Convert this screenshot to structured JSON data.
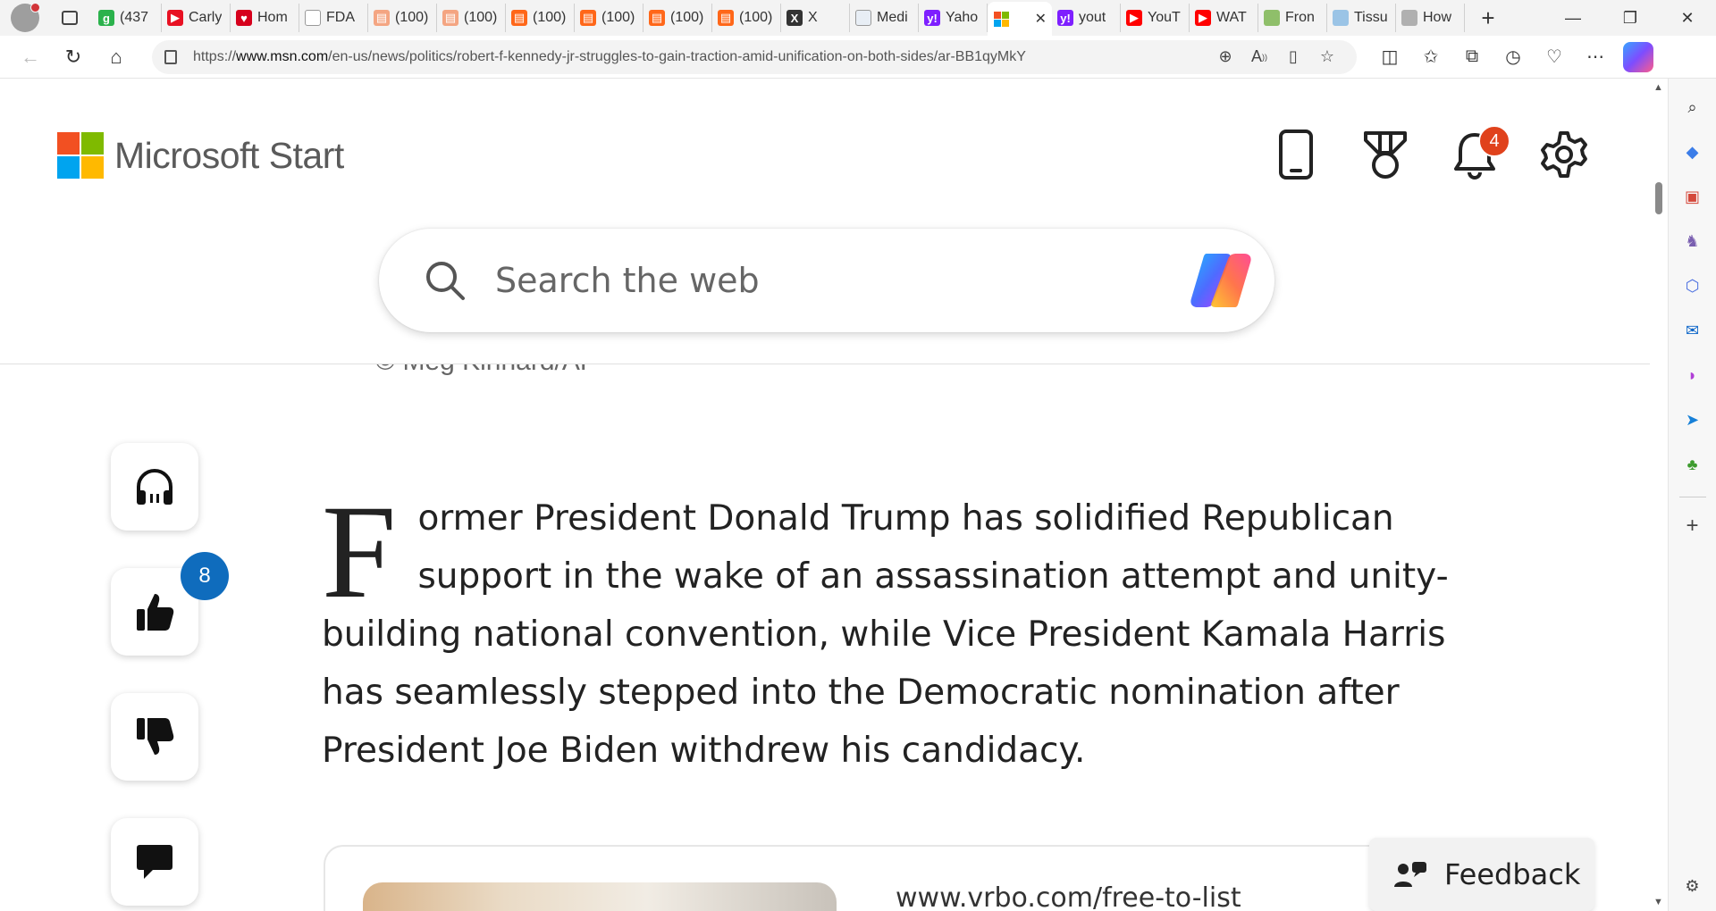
{
  "browser": {
    "tabs": [
      {
        "label": "(437",
        "fav_color": "#2bb24c",
        "fav_text": "g"
      },
      {
        "label": "Carly",
        "fav_color": "#e81123",
        "fav_text": "▶"
      },
      {
        "label": "Hom",
        "fav_color": "#d6001c",
        "fav_text": "♥"
      },
      {
        "label": "FDA",
        "fav_color": "#ffffff",
        "fav_text": ""
      },
      {
        "label": "(100)",
        "fav_color": "#f4a582",
        "fav_text": "▤"
      },
      {
        "label": "(100)",
        "fav_color": "#f4a582",
        "fav_text": "▤"
      },
      {
        "label": "(100)",
        "fav_color": "#ff6719",
        "fav_text": "▤"
      },
      {
        "label": "(100)",
        "fav_color": "#ff6719",
        "fav_text": "▤"
      },
      {
        "label": "(100)",
        "fav_color": "#ff6719",
        "fav_text": "▤"
      },
      {
        "label": "(100)",
        "fav_color": "#ff6719",
        "fav_text": "▤"
      },
      {
        "label": "X",
        "fav_color": "#333333",
        "fav_text": "X"
      },
      {
        "label": "Medi",
        "fav_color": "#e8eef5",
        "fav_text": ""
      },
      {
        "label": "Yaho",
        "fav_color": "#7e1fff",
        "fav_text": "y!"
      },
      {
        "label": "",
        "fav_color": "#ffffff",
        "fav_text": "",
        "active": true
      },
      {
        "label": "yout",
        "fav_color": "#7e1fff",
        "fav_text": "y!"
      },
      {
        "label": "YouT",
        "fav_color": "#ff0000",
        "fav_text": "▶"
      },
      {
        "label": "WAT",
        "fav_color": "#ff0000",
        "fav_text": "▶"
      },
      {
        "label": "Fron",
        "fav_color": "#8fbf6a",
        "fav_text": ""
      },
      {
        "label": "Tissu",
        "fav_color": "#9bc4e6",
        "fav_text": ""
      },
      {
        "label": "How",
        "fav_color": "#b0b0b0",
        "fav_text": ""
      }
    ],
    "url_prefix": "https://",
    "url_domain": "www.msn.com",
    "url_path": "/en-us/news/politics/robert-f-kennedy-jr-struggles-to-gain-traction-amid-unification-on-both-sides/ar-BB1qyMkY"
  },
  "header": {
    "brand": "Microsoft Start",
    "notification_count": "4"
  },
  "search": {
    "placeholder": "Search the web"
  },
  "article": {
    "photo_credit": "© Meg Kinnard/AP",
    "dropcap": "F",
    "paragraph": "ormer President Donald Trump has solidified Republican support in the wake of an assassination attempt and unity-building national convention, while Vice President Kamala Harris has seamlessly stepped into the Democratic nomination after President Joe Biden withdrew his candidacy.",
    "like_count": "8"
  },
  "ad": {
    "url": "www.vrbo.com/free-to-list"
  },
  "feedback": {
    "label": "Feedback"
  },
  "colors": {
    "ms_red": "#f25022",
    "ms_green": "#7fba00",
    "ms_blue": "#00a4ef",
    "ms_yellow": "#ffb900",
    "notif_badge": "#e0421c",
    "like_badge": "#0f6cbd"
  }
}
